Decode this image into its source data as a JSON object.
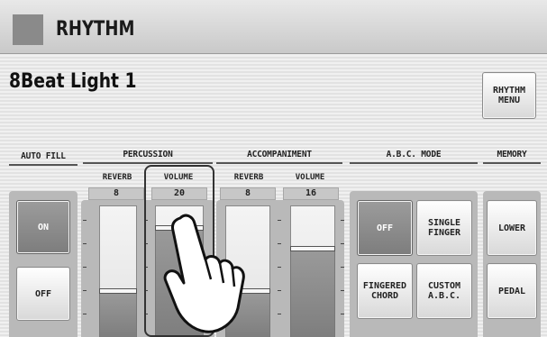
{
  "window": {
    "title": "RHYTHM"
  },
  "rhythm_name": "8Beat Light 1",
  "rhythm_menu_label": "RHYTHM\nMENU",
  "sections": {
    "auto_fill": {
      "label": "AUTO FILL",
      "on": "ON",
      "off": "OFF",
      "state": "ON"
    },
    "percussion": {
      "label": "PERCUSSION",
      "reverb": {
        "label": "REVERB",
        "value": "8",
        "level": 0.35
      },
      "volume": {
        "label": "VOLUME",
        "value": "20",
        "level": 0.83
      }
    },
    "accompaniment": {
      "label": "ACCOMPANIMENT",
      "reverb": {
        "label": "REVERB",
        "value": "8",
        "level": 0.35
      },
      "volume": {
        "label": "VOLUME",
        "value": "16",
        "level": 0.67
      }
    },
    "abc_mode": {
      "label": "A.B.C. MODE",
      "buttons": [
        "OFF",
        "SINGLE\nFINGER",
        "FINGERED\nCHORD",
        "CUSTOM\nA.B.C."
      ],
      "selected": "OFF"
    },
    "memory": {
      "label": "MEMORY",
      "lower": "LOWER",
      "pedal": "PEDAL"
    }
  },
  "colors": {
    "selected": "#8a8a8a",
    "panel_bg": "#b9b9b9"
  }
}
